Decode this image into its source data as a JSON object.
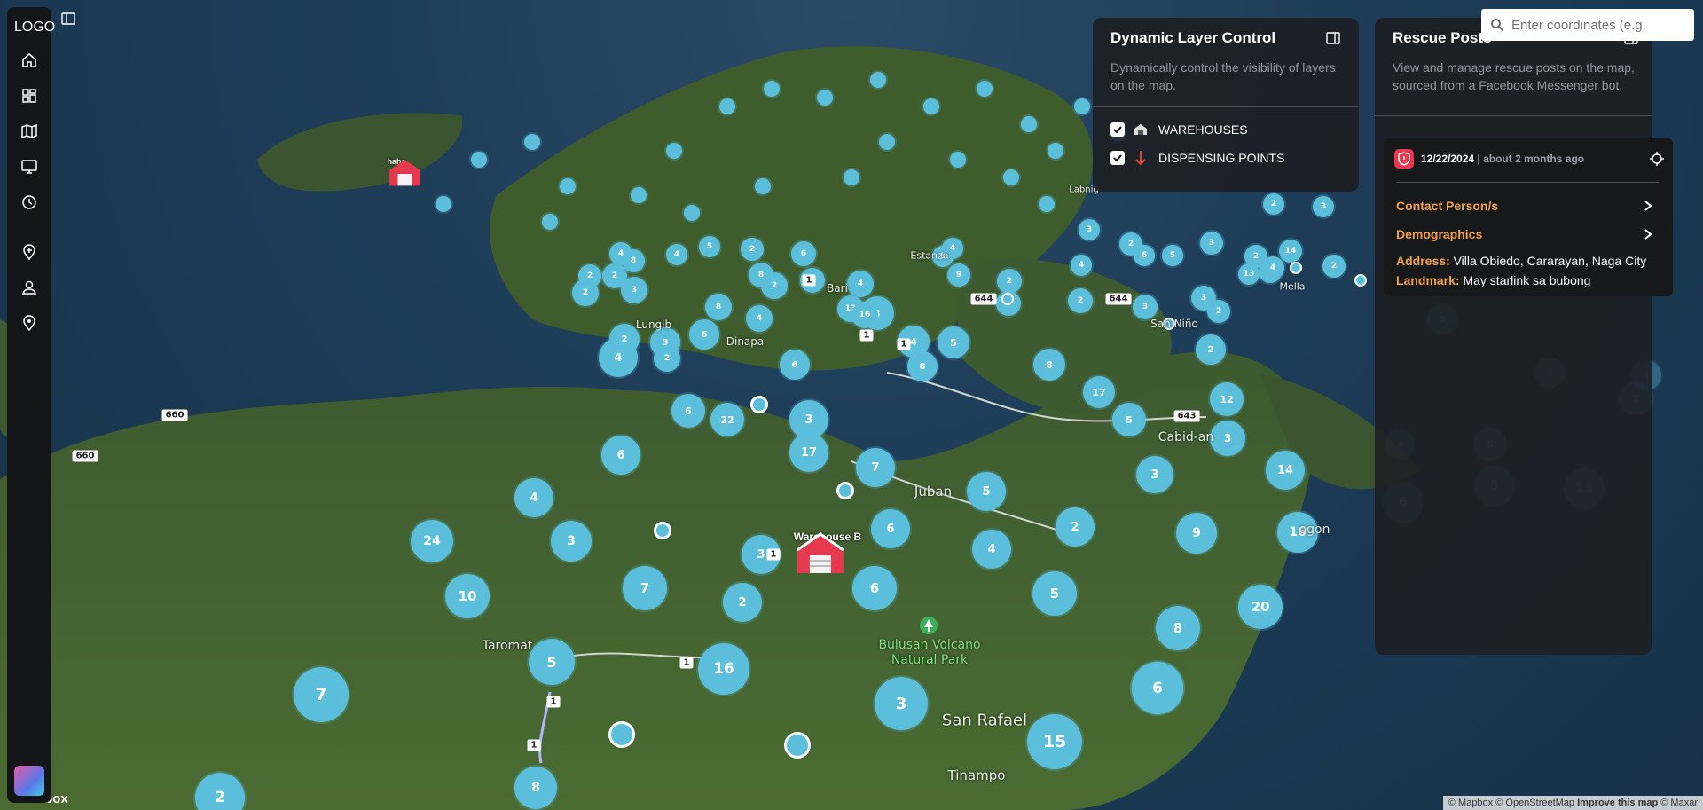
{
  "app": {
    "logo": "LOGO"
  },
  "sidebar": {
    "items": [
      {
        "icon": "home-icon"
      },
      {
        "icon": "dashboard-icon"
      },
      {
        "icon": "map-icon"
      },
      {
        "icon": "monitor-icon"
      },
      {
        "icon": "history-icon"
      },
      {
        "icon": "add-location-icon"
      },
      {
        "icon": "user-pin-icon"
      },
      {
        "icon": "location-pin-icon"
      }
    ]
  },
  "search": {
    "placeholder": "Enter coordinates (e.g."
  },
  "layer_panel": {
    "title": "Dynamic Layer Control",
    "description": "Dynamically control the visibility of layers on the map.",
    "layers": [
      {
        "label": "WAREHOUSES",
        "checked": true,
        "icon": "warehouse-icon"
      },
      {
        "label": "DISPENSING POINTS",
        "checked": true,
        "icon": "down-arrow-icon"
      }
    ]
  },
  "rescue_panel": {
    "title": "Rescue Posts",
    "description": "View and manage rescue posts on the map, sourced from a Facebook Messenger bot.",
    "post": {
      "date": "12/22/2024",
      "relative": "| about 2 months ago",
      "contact_label": "Contact Person/s",
      "demographics_label": "Demographics",
      "address_key": "Address:",
      "address_value": "Villa Obiedo, Cararayan, Naga City",
      "landmark_key": "Landmark:",
      "landmark_value": "May starlink sa bubong"
    }
  },
  "map": {
    "attribution": {
      "mapbox": "© Mapbox",
      "osm": "© OpenStreetMap",
      "improve": "Improve this map",
      "maxar": "© Maxar"
    },
    "mapbox_word": "box",
    "warehouses": [
      {
        "label": "Warehouse B"
      },
      {
        "label": "haha"
      }
    ],
    "places": [
      "Juban",
      "Taromat",
      "Bulusan Volcano Natural Park",
      "San Rafael",
      "Tinampo",
      "Cabid-an",
      "Lungib",
      "Dinapa",
      "Bari",
      "Estanza",
      "Labnig",
      "San Niño",
      "Mella",
      "ogon"
    ],
    "road_shields": [
      "644",
      "644",
      "643",
      "660",
      "660",
      "1",
      "1",
      "1",
      "1",
      "1",
      "1",
      "1"
    ],
    "clusters": [
      "2",
      "8",
      "7",
      "5",
      "16",
      "15",
      "3",
      "6",
      "24",
      "10",
      "3",
      "7",
      "2",
      "3",
      "6",
      "6",
      "7",
      "17",
      "4",
      "6",
      "4",
      "3",
      "6",
      "22",
      "5",
      "4",
      "2",
      "5",
      "9",
      "16",
      "20",
      "8",
      "6",
      "14",
      "3",
      "3",
      "12",
      "5",
      "17",
      "2",
      "8",
      "6",
      "3",
      "4",
      "5",
      "8",
      "3",
      "6",
      "2",
      "2",
      "2",
      "3",
      "8",
      "4",
      "2",
      "6",
      "13",
      "4",
      "7",
      "16",
      "2",
      "2",
      "4",
      "8",
      "4",
      "5",
      "2",
      "8",
      "8",
      "9",
      "4",
      "2",
      "4",
      "3",
      "2",
      "2",
      "3",
      "4",
      "6",
      "5",
      "3",
      "2",
      "2",
      "3",
      "2",
      "13",
      "2",
      "3",
      "14",
      "4",
      "2"
    ],
    "faded_clusters": [
      "5",
      "2",
      "4",
      "2",
      "4",
      "5",
      "13",
      "5",
      "6"
    ]
  }
}
